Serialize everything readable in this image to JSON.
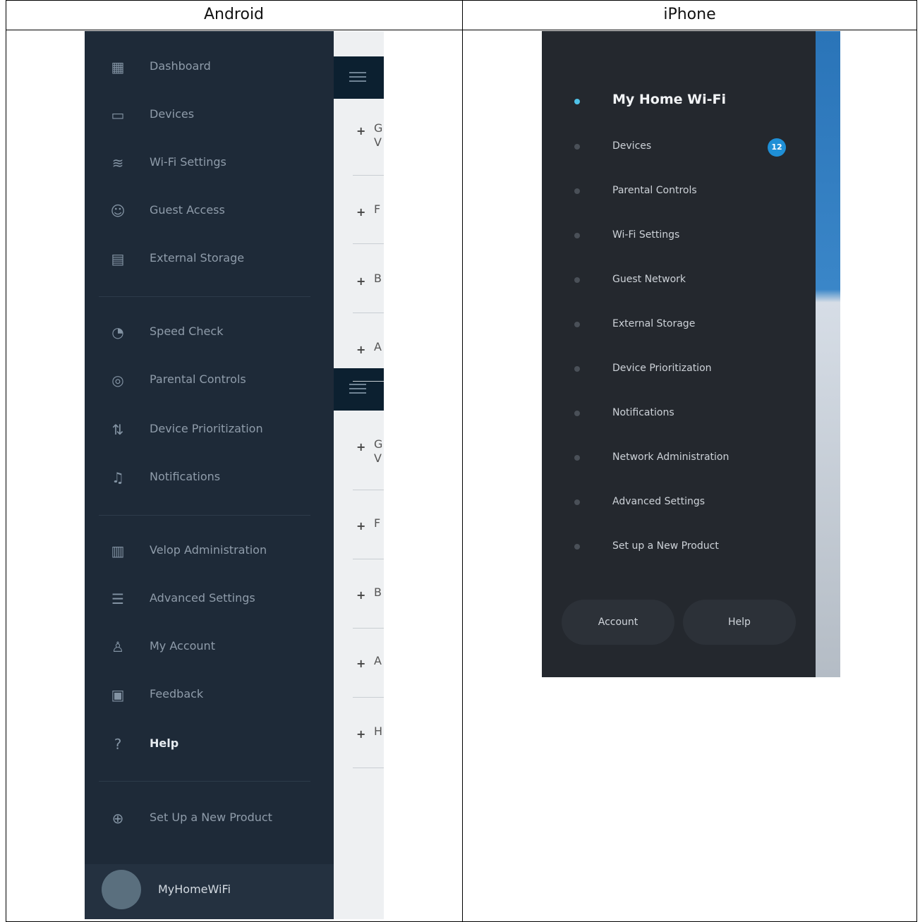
{
  "table": {
    "col_android": "Android",
    "col_iphone": "iPhone"
  },
  "android": {
    "menu": [
      {
        "label": "Dashboard",
        "icon": "dashboard-icon",
        "glyph": "▦"
      },
      {
        "label": "Devices",
        "icon": "devices-icon",
        "glyph": "▭"
      },
      {
        "label": "Wi-Fi Settings",
        "icon": "wifi-icon",
        "glyph": "≋"
      },
      {
        "label": "Guest Access",
        "icon": "guest-icon",
        "glyph": "☺"
      },
      {
        "label": "External Storage",
        "icon": "storage-icon",
        "glyph": "▤"
      },
      {
        "label": "Speed Check",
        "icon": "speed-icon",
        "glyph": "◔"
      },
      {
        "label": "Parental Controls",
        "icon": "parental-icon",
        "glyph": "◎"
      },
      {
        "label": "Device Prioritization",
        "icon": "priority-icon",
        "glyph": "⇅"
      },
      {
        "label": "Notifications",
        "icon": "bell-icon",
        "glyph": "♫"
      },
      {
        "label": "Velop Administration",
        "icon": "admin-icon",
        "glyph": "▥"
      },
      {
        "label": "Advanced Settings",
        "icon": "sliders-icon",
        "glyph": "☰"
      },
      {
        "label": "My Account",
        "icon": "account-icon",
        "glyph": "♙"
      },
      {
        "label": "Feedback",
        "icon": "feedback-icon",
        "glyph": "▣"
      },
      {
        "label": "Help",
        "icon": "help-icon",
        "glyph": "?"
      },
      {
        "label": "Set Up a New Product",
        "icon": "add-circle-icon",
        "glyph": "⊕"
      }
    ],
    "profile_name": "MyHomeWiFi",
    "behind_items": [
      {
        "plus": "+",
        "text": "G\nV"
      },
      {
        "plus": "+",
        "text": "F"
      },
      {
        "plus": "+",
        "text": "B"
      },
      {
        "plus": "+",
        "text": "A"
      },
      {
        "plus": "+",
        "text": "G\nV"
      },
      {
        "plus": "+",
        "text": "F"
      },
      {
        "plus": "+",
        "text": "B"
      },
      {
        "plus": "+",
        "text": "A"
      },
      {
        "plus": "+",
        "text": "H"
      }
    ]
  },
  "iphone": {
    "network_name": "My Home Wi-Fi",
    "menu": [
      {
        "label": "Devices",
        "badge": "12"
      },
      {
        "label": "Parental Controls"
      },
      {
        "label": "Wi-Fi Settings"
      },
      {
        "label": "Guest Network"
      },
      {
        "label": "External Storage"
      },
      {
        "label": "Device Prioritization"
      },
      {
        "label": "Notifications"
      },
      {
        "label": "Network Administration"
      },
      {
        "label": "Advanced Settings"
      },
      {
        "label": "Set up a New Product"
      }
    ],
    "account_label": "Account",
    "help_label": "Help"
  }
}
